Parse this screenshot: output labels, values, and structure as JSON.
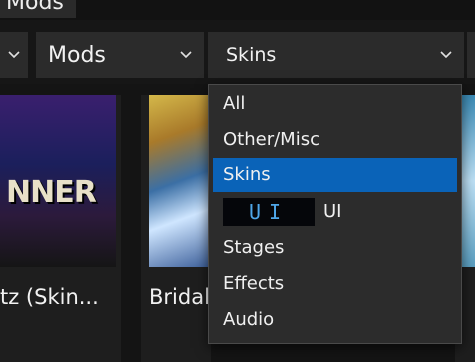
{
  "tabs": {
    "mods_label": "Mods"
  },
  "filters": {
    "category_value": "Mods",
    "type_value": "Skins"
  },
  "cards": [
    {
      "title": "tz (Skin...",
      "banner": "NNER"
    },
    {
      "title": "Bridal"
    }
  ],
  "dropdown": {
    "items": [
      {
        "label": "All"
      },
      {
        "label": "Other/Misc"
      },
      {
        "label": "Skins",
        "selected": true
      },
      {
        "label": "UI",
        "icon_text": "UI"
      },
      {
        "label": "Stages"
      },
      {
        "label": "Effects"
      },
      {
        "label": "Audio"
      }
    ],
    "selected_color": "#0a63b8"
  }
}
